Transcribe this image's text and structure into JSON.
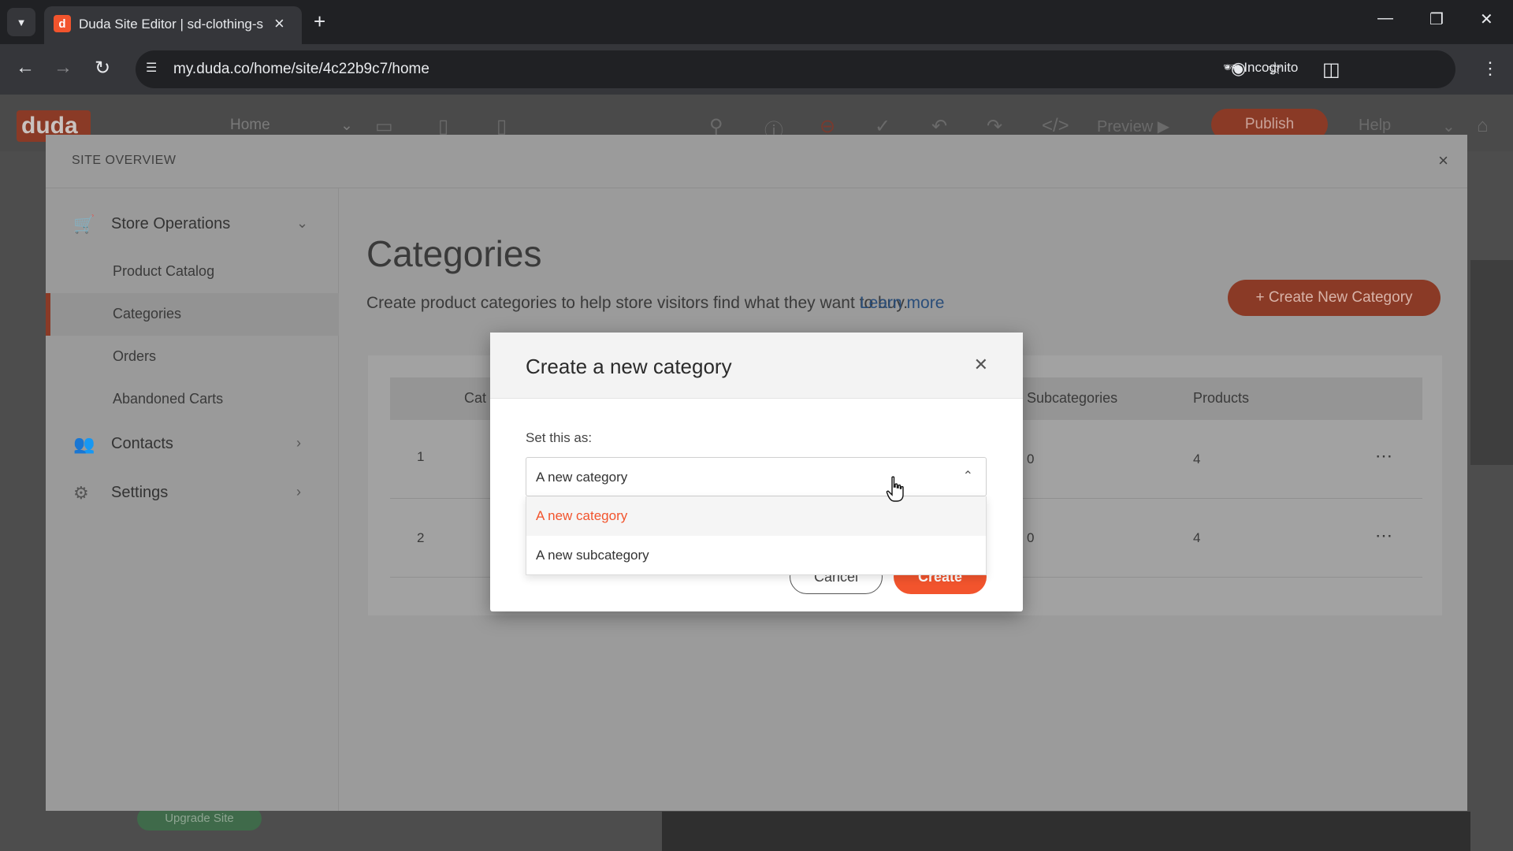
{
  "browser": {
    "tab_title": "Duda Site Editor | sd-clothing-s",
    "tab_favicon_letter": "d",
    "url": "my.duda.co/home/site/4c22b9c7/home",
    "incognito_label": "Incognito"
  },
  "editor": {
    "logo": "duda",
    "page_select": "Home",
    "preview_label": "Preview",
    "publish_label": "Publish",
    "help_label": "Help",
    "upgrade_label": "Upgrade Site"
  },
  "overview": {
    "title": "SITE OVERVIEW",
    "sidebar": {
      "store_ops_label": "Store Operations",
      "items": [
        "Product Catalog",
        "Categories",
        "Orders",
        "Abandoned Carts"
      ],
      "contacts_label": "Contacts",
      "settings_label": "Settings"
    },
    "main": {
      "title": "Categories",
      "description": "Create product categories to help store visitors find what they want to buy.",
      "learn_more": "Learn more",
      "create_new_label": "+ Create New Category",
      "table": {
        "col_category_partial": "Cat",
        "col_subcategories": "Subcategories",
        "col_products": "Products",
        "rows": [
          {
            "index": "1",
            "subcategories": "0",
            "products": "4"
          },
          {
            "index": "2",
            "subcategories": "0",
            "products": "4"
          }
        ]
      }
    }
  },
  "modal": {
    "title": "Create a new category",
    "set_label": "Set this as:",
    "selected_value": "A new category",
    "options": [
      "A new category",
      "A new subcategory"
    ],
    "cancel_label": "Cancel",
    "create_label": "Create"
  },
  "colors": {
    "accent": "#f2542d",
    "link": "#2a4e7a"
  }
}
